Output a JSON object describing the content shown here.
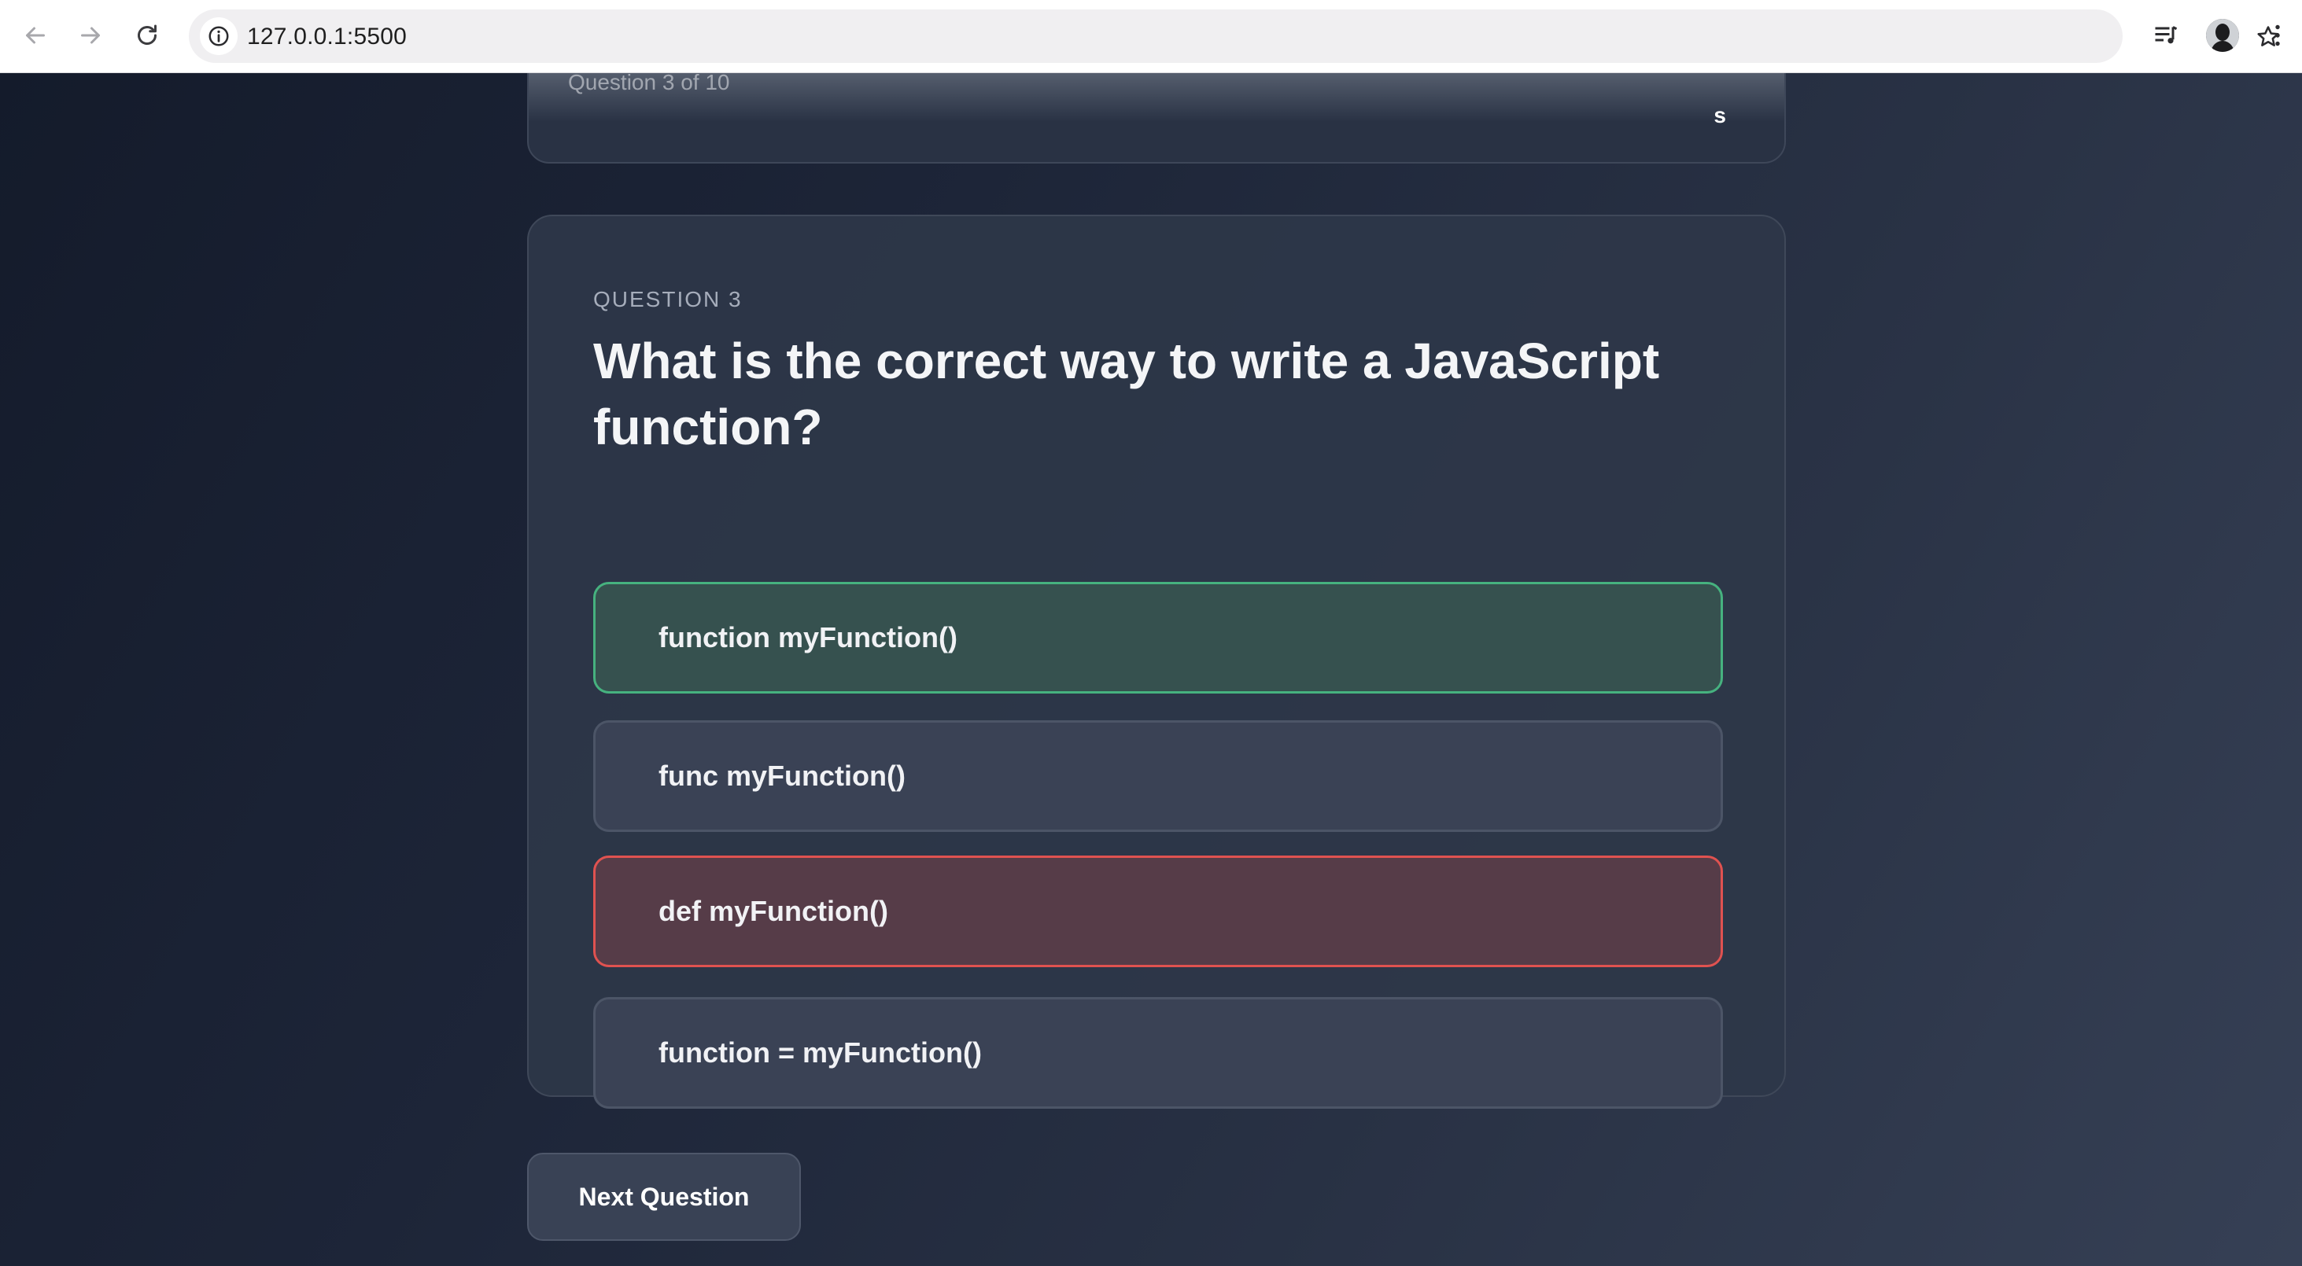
{
  "browser": {
    "url": "127.0.0.1:5500"
  },
  "top_card": {
    "hint_text": "Question 3 of 10",
    "right_text": "s"
  },
  "question": {
    "number_label": "QUESTION 3",
    "text": "What is the correct way to write a JavaScript function?",
    "options": [
      {
        "label": "function myFunction()",
        "state": "correct"
      },
      {
        "label": "func myFunction()",
        "state": "neutral"
      },
      {
        "label": "def myFunction()",
        "state": "wrong"
      },
      {
        "label": "function = myFunction()",
        "state": "neutral"
      }
    ]
  },
  "next_button": {
    "label": "Next Question"
  },
  "colors": {
    "correct_border": "#46b27f",
    "wrong_border": "#e05250",
    "page_bg": "#1d2538"
  }
}
